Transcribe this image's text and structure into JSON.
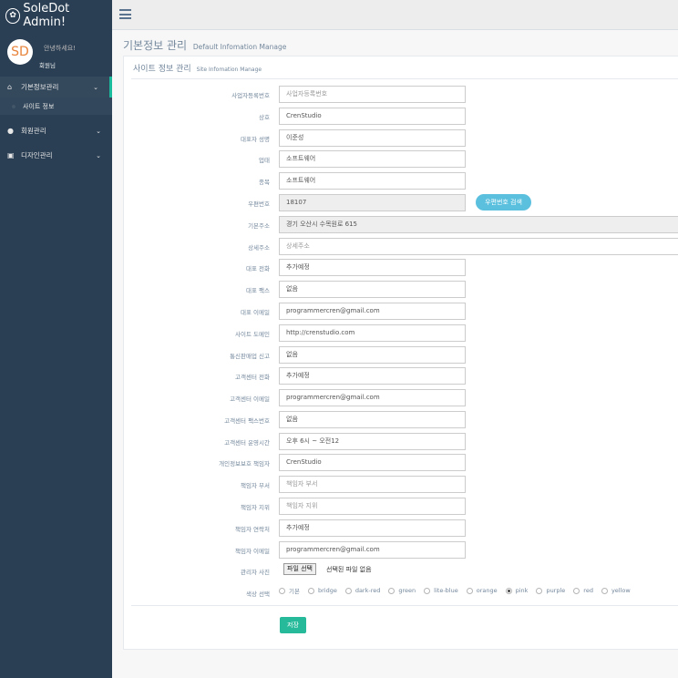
{
  "brand": {
    "title": "SoleDot Admin!",
    "icon": "paw-icon"
  },
  "profile": {
    "avatar_text": "SD",
    "greeting": "안녕하세요!",
    "name": "회원님",
    "avatar_color": "#e8833a"
  },
  "sidebar": {
    "items": [
      {
        "label": "기본정보관리",
        "icon": "home-icon",
        "active": true
      },
      {
        "label": "회원관리",
        "icon": "user-icon"
      },
      {
        "label": "디자인관리",
        "icon": "image-icon"
      }
    ],
    "subitem": "사이트 정보"
  },
  "page": {
    "title": "기본정보 관리",
    "subtitle": "Default Infomation Manage"
  },
  "panel": {
    "title": "사이트 정보 관리",
    "subtitle": "Site Infomation Manage"
  },
  "fields": [
    {
      "label": "사업자등록번호",
      "value": "",
      "placeholder": "사업자등록번호"
    },
    {
      "label": "상호",
      "value": "CrenStudio"
    },
    {
      "label": "대표자 성명",
      "value": "이준성"
    },
    {
      "label": "업태",
      "value": "소프트웨어"
    },
    {
      "label": "종목",
      "value": "소프트웨어"
    },
    {
      "label": "우편번호",
      "value": "18107",
      "readonly": true
    },
    {
      "label": "기본주소",
      "value": "경기 오산시 수목원로 615",
      "readonly": true
    },
    {
      "label": "상세주소",
      "value": "",
      "placeholder": "상세주소"
    },
    {
      "label": "대표 전화",
      "value": "추가예정"
    },
    {
      "label": "대표 팩스",
      "value": "없음"
    },
    {
      "label": "대표 이메일",
      "value": "programmercren@gmail.com"
    },
    {
      "label": "사이트 도메인",
      "value": "http://crenstudio.com"
    },
    {
      "label": "통신판매업 신고",
      "value": "없음"
    },
    {
      "label": "고객센터 전화",
      "value": "추가예정"
    },
    {
      "label": "고객센터 이메일",
      "value": "programmercren@gmail.com"
    },
    {
      "label": "고객센터 팩스번호",
      "value": "없음"
    },
    {
      "label": "고객센터 운영시간",
      "value": "오후 6시 ~ 오전12"
    },
    {
      "label": "개인정보보호 책임자",
      "value": "CrenStudio"
    },
    {
      "label": "책임자 부서",
      "value": "",
      "placeholder": "책임자 부서"
    },
    {
      "label": "책임자 지위",
      "value": "",
      "placeholder": "책임자 지위"
    },
    {
      "label": "책임자 연락처",
      "value": "추가예정"
    },
    {
      "label": "책임자 이메일",
      "value": "programmercren@gmail.com"
    }
  ],
  "zip_button": "우편번호 검색",
  "admin_photo": {
    "label": "관리자 사진",
    "button": "파일 선택",
    "status": "선택된 파일 없음"
  },
  "color_select": {
    "label": "색상 선택",
    "options": [
      "기본",
      "bridge",
      "dark-red",
      "green",
      "lite-blue",
      "orange",
      "pink",
      "purple",
      "red",
      "yellow"
    ],
    "selected": "pink"
  },
  "save_button": "저장",
  "colors": {
    "sidebar": "#2a3f54",
    "accent": "#1abb9c",
    "save": "#26b99a",
    "zip_button": "#5bc0de"
  }
}
